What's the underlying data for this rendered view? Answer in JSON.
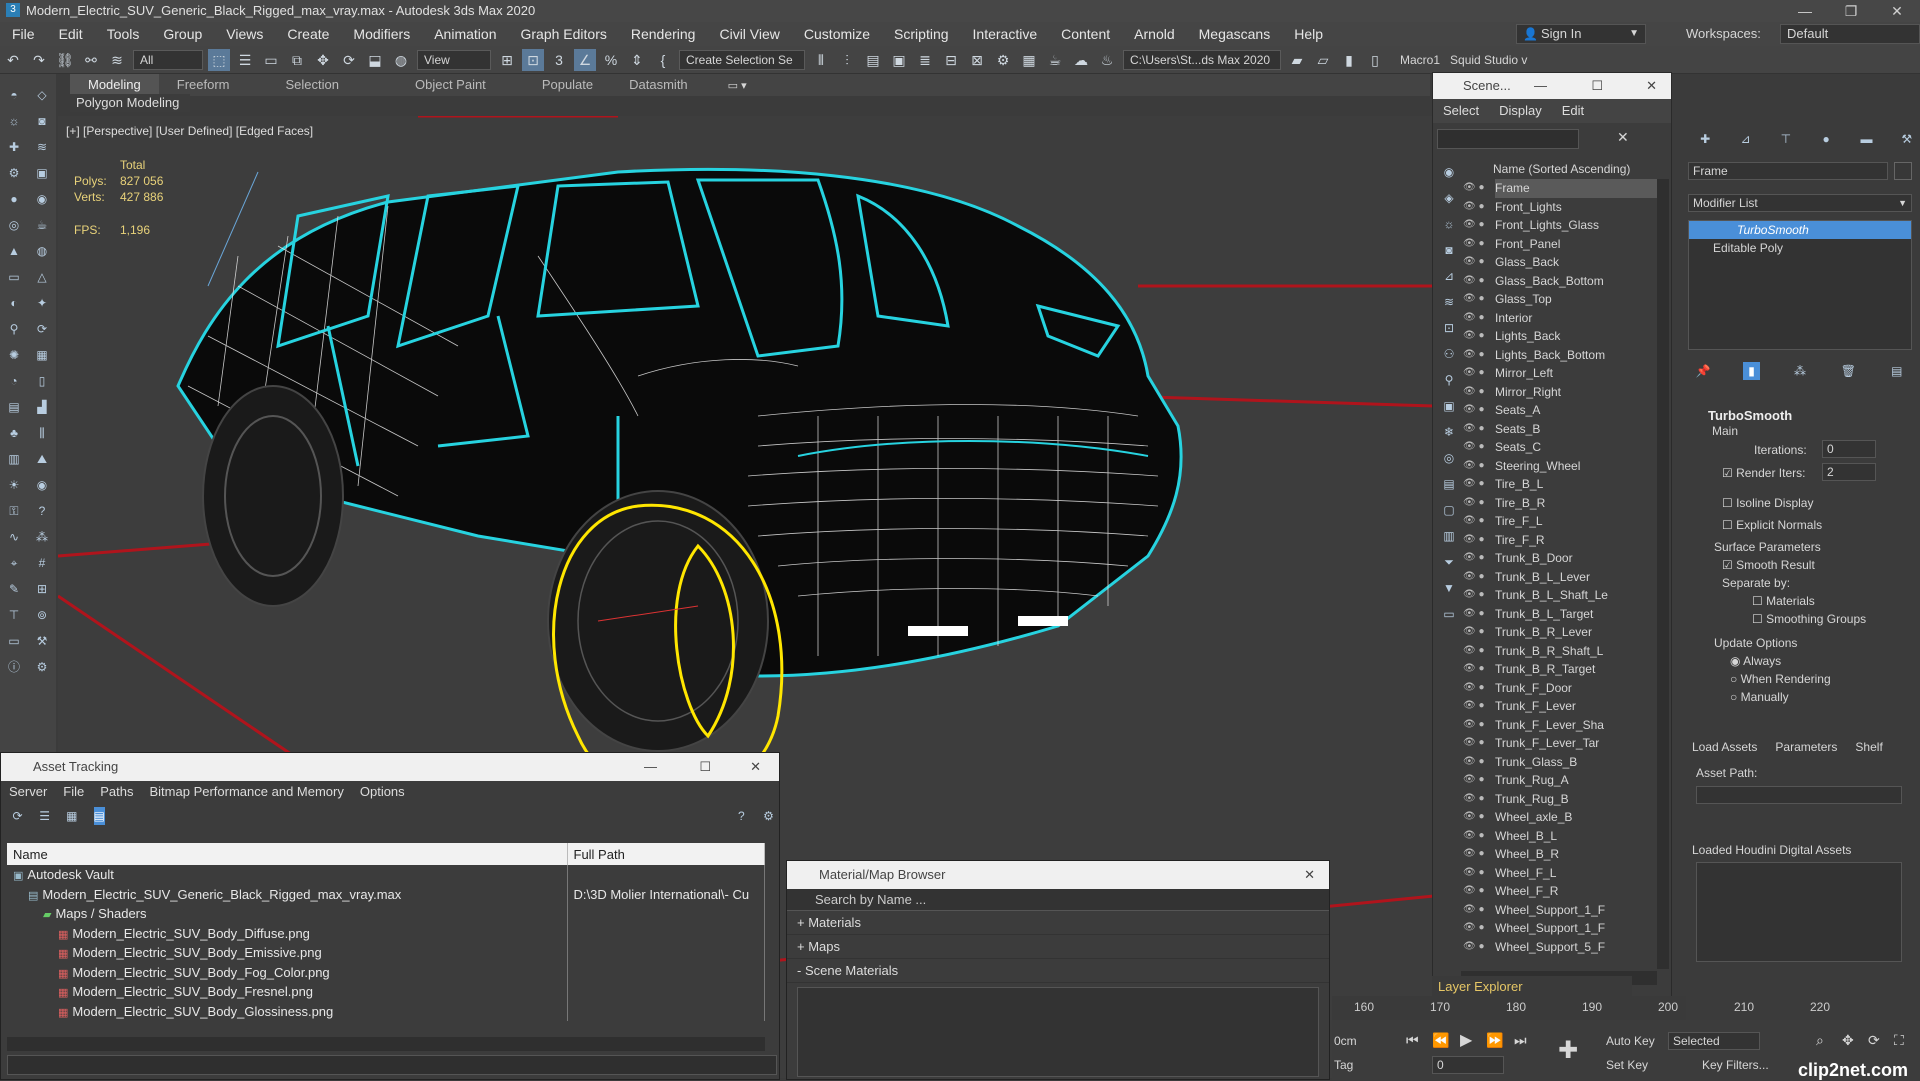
{
  "window": {
    "title": "Modern_Electric_SUV_Generic_Black_Rigged_max_vray.max - Autodesk 3ds Max 2020",
    "controls": [
      "—",
      "❐",
      "✕"
    ]
  },
  "menu": [
    "File",
    "Edit",
    "Tools",
    "Group",
    "Views",
    "Create",
    "Modifiers",
    "Animation",
    "Graph Editors",
    "Rendering",
    "Civil View",
    "Customize",
    "Scripting",
    "Interactive",
    "Content",
    "Arnold",
    "Megascans",
    "Help"
  ],
  "signin": "Sign In",
  "workspaces_label": "Workspaces:",
  "workspace_value": "Default",
  "toolbar": {
    "filter_value": "All",
    "view_value": "View",
    "selection_set": "Create Selection Se",
    "path_value": "C:\\Users\\St...ds Max 2020",
    "macro": "Macro1",
    "studio": "Squid Studio v"
  },
  "ribbon": {
    "tabs": [
      "Modeling",
      "Freeform",
      "Selection",
      "Object Paint",
      "Populate",
      "Datasmith"
    ],
    "subtab": "Polygon Modeling"
  },
  "viewport": {
    "label": "[+] [Perspective] [User Defined] [Edged Faces]",
    "total_label": "Total",
    "polys_label": "Polys:",
    "polys_value": "827 056",
    "verts_label": "Verts:",
    "verts_value": "427 886",
    "fps_label": "FPS:",
    "fps_value": "1,196"
  },
  "scene_explorer": {
    "title": "Scene...",
    "menu": [
      "Select",
      "Display",
      "Edit"
    ],
    "column": "Name (Sorted Ascending)",
    "items": [
      "Frame",
      "Front_Lights",
      "Front_Lights_Glass",
      "Front_Panel",
      "Glass_Back",
      "Glass_Back_Bottom",
      "Glass_Top",
      "Interior",
      "Lights_Back",
      "Lights_Back_Bottom",
      "Mirror_Left",
      "Mirror_Right",
      "Seats_A",
      "Seats_B",
      "Seats_C",
      "Steering_Wheel",
      "Tire_B_L",
      "Tire_B_R",
      "Tire_F_L",
      "Tire_F_R",
      "Trunk_B_Door",
      "Trunk_B_L_Lever",
      "Trunk_B_L_Shaft_Le",
      "Trunk_B_L_Target",
      "Trunk_B_R_Lever",
      "Trunk_B_R_Shaft_L",
      "Trunk_B_R_Target",
      "Trunk_F_Door",
      "Trunk_F_Lever",
      "Trunk_F_Lever_Sha",
      "Trunk_F_Lever_Tar",
      "Trunk_Glass_B",
      "Trunk_Rug_A",
      "Trunk_Rug_B",
      "Wheel_axle_B",
      "Wheel_B_L",
      "Wheel_B_R",
      "Wheel_F_L",
      "Wheel_F_R",
      "Wheel_Support_1_F",
      "Wheel_Support_1_F",
      "Wheel_Support_5_F"
    ],
    "layer_explorer": "Layer Explorer"
  },
  "command_panel": {
    "object_name": "Frame",
    "modifier_list": "Modifier List",
    "stack": [
      "TurboSmooth",
      "Editable Poly"
    ],
    "rollout_title": "TurboSmooth",
    "main_label": "Main",
    "iterations_label": "Iterations:",
    "iterations_value": "0",
    "render_iters_label": "Render Iters:",
    "render_iters_value": "2",
    "isoline": "Isoline Display",
    "explicit_normals": "Explicit Normals",
    "surface_params": "Surface Parameters",
    "smooth_result": "Smooth Result",
    "separate_by": "Separate by:",
    "materials": "Materials",
    "smoothing_groups": "Smoothing Groups",
    "update_options": "Update Options",
    "always": "Always",
    "when_rendering": "When Rendering",
    "manually": "Manually"
  },
  "assets_panel": {
    "tabs": [
      "Load Assets",
      "Parameters",
      "Shelf"
    ],
    "asset_path": "Asset Path:",
    "loaded_houdini": "Loaded Houdini Digital Assets"
  },
  "asset_tracking": {
    "title": "Asset Tracking",
    "menu": [
      "Server",
      "File",
      "Paths",
      "Bitmap Performance and Memory",
      "Options"
    ],
    "col_name": "Name",
    "col_path": "Full Path",
    "rows": [
      {
        "name": "Autodesk Vault",
        "path": "",
        "indent": 0
      },
      {
        "name": "Modern_Electric_SUV_Generic_Black_Rigged_max_vray.max",
        "path": "D:\\3D Molier International\\- Cu",
        "indent": 1
      },
      {
        "name": "Maps / Shaders",
        "path": "",
        "indent": 2
      },
      {
        "name": "Modern_Electric_SUV_Body_Diffuse.png",
        "path": "",
        "indent": 3
      },
      {
        "name": "Modern_Electric_SUV_Body_Emissive.png",
        "path": "",
        "indent": 3
      },
      {
        "name": "Modern_Electric_SUV_Body_Fog_Color.png",
        "path": "",
        "indent": 3
      },
      {
        "name": "Modern_Electric_SUV_Body_Fresnel.png",
        "path": "",
        "indent": 3
      },
      {
        "name": "Modern_Electric_SUV_Body_Glossiness.png",
        "path": "",
        "indent": 3
      }
    ]
  },
  "material_browser": {
    "title": "Material/Map Browser",
    "search_placeholder": "Search by Name ...",
    "sections": [
      "+ Materials",
      "+ Maps",
      "- Scene Materials"
    ]
  },
  "timeline": {
    "ticks": [
      "160",
      "170",
      "180",
      "190",
      "200",
      "210",
      "220"
    ],
    "units": "0cm",
    "tag": "Tag",
    "auto_key": "Auto Key",
    "set_key": "Set Key",
    "selected": "Selected",
    "key_filters": "Key Filters...",
    "frame_value": "0"
  },
  "watermark": "clip2net.com",
  "colors": {
    "accent": "#4a8fd8",
    "wire_cyan": "#27d3e0",
    "wheel_yellow": "#ffe600",
    "grid_red": "#b0141c"
  }
}
